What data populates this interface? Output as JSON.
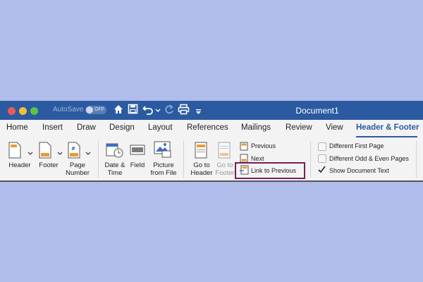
{
  "window": {
    "document_title": "Document1",
    "autosave_label": "AutoSave",
    "autosave_state": "OFF"
  },
  "tabs": [
    {
      "label": "Home"
    },
    {
      "label": "Insert"
    },
    {
      "label": "Draw"
    },
    {
      "label": "Design"
    },
    {
      "label": "Layout"
    },
    {
      "label": "References"
    },
    {
      "label": "Mailings"
    },
    {
      "label": "Review"
    },
    {
      "label": "View"
    },
    {
      "label": "Header & Footer",
      "active": true
    }
  ],
  "ribbon": {
    "header": "Header",
    "footer": "Footer",
    "page_number_l1": "Page",
    "page_number_l2": "Number",
    "date_time_l1": "Date &",
    "date_time_l2": "Time",
    "field": "Field",
    "picture_l1": "Picture",
    "picture_l2": "from File",
    "go_header_l1": "Go to",
    "go_header_l2": "Header",
    "go_footer_l1": "Go to",
    "go_footer_l2": "Footer",
    "previous": "Previous",
    "next": "Next",
    "link_previous": "Link to Previous",
    "diff_first": "Different First Page",
    "diff_odd_even": "Different Odd & Even Pages",
    "show_doc_text": "Show Document Text"
  },
  "options": {
    "different_first_page": false,
    "different_odd_even": false,
    "show_document_text": true
  },
  "colors": {
    "background": "#b0bdea",
    "titlebar": "#2c5aa0",
    "accent": "#2c5aa0",
    "highlight_box": "#7a1d5c"
  },
  "icons": {
    "close": "close-button",
    "minimize": "minimize-button",
    "zoom": "zoom-button",
    "home": "home-icon",
    "save": "save-icon",
    "undo": "undo-icon",
    "redo": "redo-icon",
    "print": "print-icon",
    "customize": "customize-toolbar-icon"
  }
}
